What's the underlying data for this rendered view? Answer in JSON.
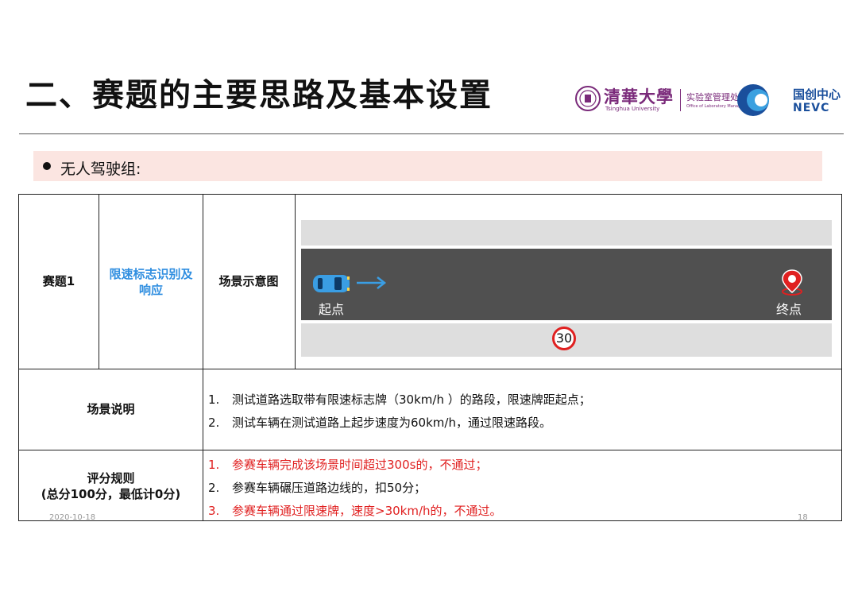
{
  "slide": {
    "title": "二、赛题的主要思路及基本设置"
  },
  "logos": {
    "tsinghua_name": "清華大學",
    "tsinghua_en": "Tsinghua University",
    "lab_office": "实验室管理处",
    "lab_office_en": "Office of Laboratory Management",
    "nevc_cn": "国创中心",
    "nevc_en": "NEVC"
  },
  "group": {
    "label": "无人驾驶组:"
  },
  "table": {
    "task_no": "赛题1",
    "task_name": "限速标志识别及响应",
    "diagram_label": "场景示意图",
    "scene_desc_label": "场景说明",
    "scene_desc": [
      {
        "num": "1.",
        "text": "测试道路选取带有限速标志牌（30km/h ）的路段，限速牌距起点；"
      },
      {
        "num": "2.",
        "text": "测试车辆在测试道路上起步速度为60km/h，通过限速路段。"
      }
    ],
    "scoring_label": "评分规则",
    "scoring_sub": "(总分100分，最低计0分)",
    "scoring": [
      {
        "num": "1.",
        "text": "参赛车辆完成该场景时间超过300s的，不通过；",
        "color": "#e02020"
      },
      {
        "num": "2.",
        "text": "参赛车辆碾压道路边线的，扣50分；",
        "color": "#111111"
      },
      {
        "num": "3.",
        "text": "参赛车辆通过限速牌，速度>30km/h的，不通过。",
        "color": "#e02020"
      }
    ]
  },
  "scene": {
    "start_label": "起点",
    "end_label": "终点",
    "speed_limit": "30",
    "road_color": "#505050",
    "lane_color": "#dedede",
    "car_color": "#3a9ee4",
    "pin_color": "#e02020"
  },
  "footer": {
    "date": "2020-10-18",
    "page": "18"
  }
}
